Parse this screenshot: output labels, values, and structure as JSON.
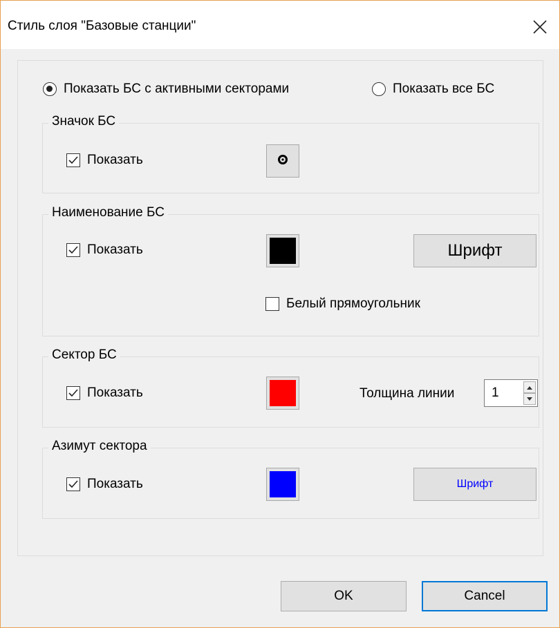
{
  "window": {
    "title": "Стиль слоя \"Базовые станции\"",
    "close_icon": "close-icon"
  },
  "display_mode": {
    "options": [
      {
        "label": "Показать БС с активными секторами",
        "selected": true
      },
      {
        "label": "Показать все БС",
        "selected": false
      }
    ]
  },
  "groups": {
    "icon": {
      "title": "Значок БС",
      "show_label": "Показать",
      "show_checked": true,
      "symbol_icon": "target-circle-icon"
    },
    "name": {
      "title": "Наименование БС",
      "show_label": "Показать",
      "show_checked": true,
      "color": "#000000",
      "font_button": "Шрифт",
      "white_rect_label": "Белый прямоугольник",
      "white_rect_checked": false
    },
    "sector": {
      "title": "Сектор БС",
      "show_label": "Показать",
      "show_checked": true,
      "color": "#ff0000",
      "line_width_label": "Толщина линии",
      "line_width_value": "1"
    },
    "azimuth": {
      "title": "Азимут сектора",
      "show_label": "Показать",
      "show_checked": true,
      "color": "#0000ff",
      "font_button": "Шрифт",
      "font_button_color": "#0000ff"
    }
  },
  "buttons": {
    "ok": "OK",
    "cancel": "Cancel"
  }
}
